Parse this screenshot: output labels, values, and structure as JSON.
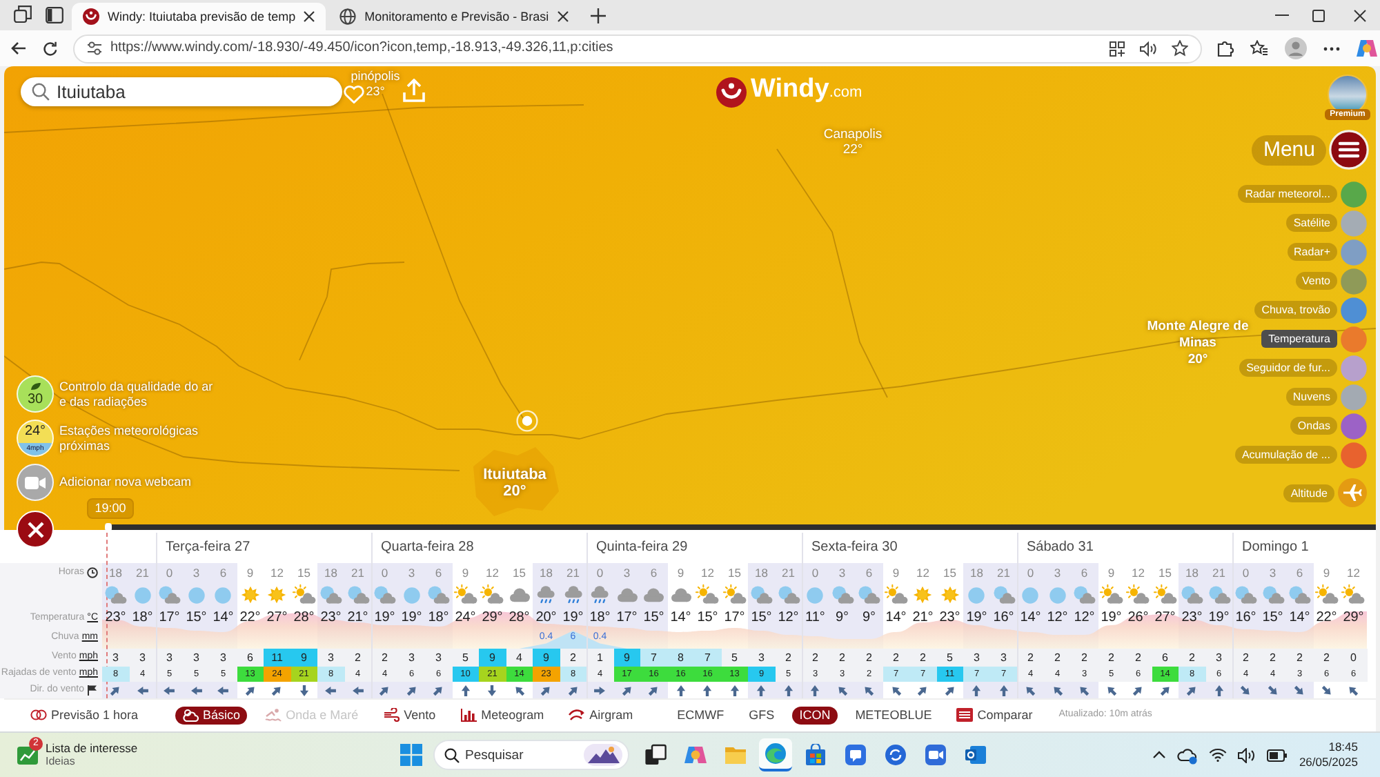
{
  "browser": {
    "tabs": [
      {
        "title": "Windy: Ituiutaba previsão de temp",
        "selected": true
      },
      {
        "title": "Monitoramento e Previsão - Brasi",
        "selected": false
      }
    ],
    "url": "https://www.windy.com/-18.930/-49.450/icon?icon,temp,-18.913,-49.326,11,p:cities"
  },
  "map": {
    "search": {
      "value": "Ituiutaba"
    },
    "logo": {
      "name": "Windy",
      "suffix": ".com"
    },
    "cities": [
      {
        "name": "pinópolis",
        "temp": "23°"
      },
      {
        "name": "Canapolis",
        "temp": "22°"
      },
      {
        "name": "Ituiutaba",
        "temp": "20°"
      },
      {
        "name": "Monte Alegre de Minas",
        "temp": "20°"
      }
    ],
    "premium": {
      "label": "Premium"
    },
    "menu": {
      "label": "Menu"
    },
    "layers": [
      {
        "label": "Radar meteorol...",
        "kind": "thumbnail",
        "color": "#58a84a",
        "selected": false
      },
      {
        "label": "Satélite",
        "kind": "thumbnail",
        "color": "#a4acb4",
        "selected": false
      },
      {
        "label": "Radar+",
        "kind": "thumbnail",
        "color": "#7f9ec4",
        "selected": false
      },
      {
        "label": "Vento",
        "kind": "thumbnail",
        "color": "#8f9a58",
        "selected": false
      },
      {
        "label": "Chuva, trovão",
        "kind": "thumbnail",
        "color": "#4f8fd4",
        "selected": false
      },
      {
        "label": "Temperatura",
        "kind": "thumbnail",
        "color": "#ea7a2c",
        "selected": true
      },
      {
        "label": "Seguidor de fur...",
        "kind": "thumbnail",
        "color": "#b7a0cc",
        "selected": false
      },
      {
        "label": "Nuvens",
        "kind": "thumbnail",
        "color": "#a3aab2",
        "selected": false
      },
      {
        "label": "Ondas",
        "kind": "thumbnail",
        "color": "#9c62c6",
        "selected": false
      },
      {
        "label": "Acumulação de ...",
        "kind": "thumbnail",
        "color": "#e8622e",
        "selected": false
      },
      {
        "label": "Altitude",
        "kind": "action",
        "color": "#e49b12",
        "selected": false
      }
    ],
    "tools": [
      {
        "kind": "air",
        "value": "30",
        "label": "Controlo da qualidade do ar e das radiações"
      },
      {
        "kind": "station",
        "value": "24°",
        "detail": "4mph",
        "label": "Estações meteorológicas próximas"
      },
      {
        "kind": "webcam",
        "label": "Adicionar nova webcam"
      }
    ],
    "timeline": {
      "time": "19:00",
      "level": 0
    }
  },
  "forecast": {
    "days": [
      {
        "hours": [
          {
            "hour": "18",
            "kind": "moon_cloud",
            "night": true,
            "temp": "23°",
            "wind": "3",
            "gust": "8",
            "wind_dir": {
              "kind": "ne"
            }
          },
          {
            "hour": "21",
            "kind": "moon",
            "night": true,
            "temp": "18°",
            "wind": "3",
            "gust": "4",
            "wind_dir": {
              "kind": "w"
            }
          }
        ]
      },
      {
        "label": "Terça-feira 27",
        "hours": [
          {
            "hour": "0",
            "kind": "moon_cloud",
            "night": true,
            "temp": "17°",
            "wind": "3",
            "gust": "5",
            "wind_dir": {
              "kind": "w"
            }
          },
          {
            "hour": "3",
            "kind": "moon",
            "night": true,
            "temp": "15°",
            "wind": "3",
            "gust": "5",
            "wind_dir": {
              "kind": "w"
            }
          },
          {
            "hour": "6",
            "kind": "moon",
            "night": true,
            "temp": "14°",
            "wind": "3",
            "gust": "5",
            "wind_dir": {
              "kind": "w"
            }
          },
          {
            "hour": "9",
            "kind": "sun",
            "night": false,
            "temp": "22°",
            "wind": "6",
            "gust": "13",
            "wind_dir": {
              "kind": "ne"
            }
          },
          {
            "hour": "12",
            "kind": "sun",
            "night": false,
            "temp": "27°",
            "wind": "11",
            "gust": "24",
            "wind_dir": {
              "kind": "ne"
            }
          },
          {
            "hour": "15",
            "kind": "sun_cloud",
            "night": false,
            "temp": "28°",
            "wind": "9",
            "gust": "21",
            "wind_dir": {
              "kind": "s"
            }
          },
          {
            "hour": "18",
            "kind": "moon_cloud",
            "night": true,
            "temp": "23°",
            "wind": "3",
            "gust": "8",
            "wind_dir": {
              "kind": "w"
            }
          },
          {
            "hour": "21",
            "kind": "moon_cloud",
            "night": true,
            "temp": "21°",
            "wind": "2",
            "gust": "4",
            "wind_dir": {
              "kind": "w"
            }
          }
        ]
      },
      {
        "label": "Quarta-feira 28",
        "hours": [
          {
            "hour": "0",
            "kind": "moon_cloud",
            "night": true,
            "temp": "19°",
            "wind": "2",
            "gust": "4",
            "wind_dir": {
              "kind": "ne"
            }
          },
          {
            "hour": "3",
            "kind": "moon",
            "night": true,
            "temp": "19°",
            "wind": "3",
            "gust": "6",
            "wind_dir": {
              "kind": "ne"
            }
          },
          {
            "hour": "6",
            "kind": "moon_cloud",
            "night": true,
            "temp": "18°",
            "wind": "3",
            "gust": "6",
            "wind_dir": {
              "kind": "ne"
            }
          },
          {
            "hour": "9",
            "kind": "sun_cloud",
            "night": false,
            "temp": "24°",
            "wind": "5",
            "gust": "10",
            "wind_dir": {
              "kind": "n"
            }
          },
          {
            "hour": "12",
            "kind": "sun_cloud",
            "night": false,
            "temp": "29°",
            "wind": "9",
            "gust": "21",
            "wind_dir": {
              "kind": "s"
            }
          },
          {
            "hour": "15",
            "kind": "cloud",
            "night": false,
            "temp": "28°",
            "wind": "4",
            "gust": "14",
            "wind_dir": {
              "kind": "nw"
            }
          },
          {
            "hour": "18",
            "kind": "rain",
            "night": true,
            "temp": "20°",
            "rain": "0.4",
            "wind": "9",
            "gust": "23",
            "wind_dir": {
              "kind": "ne"
            }
          },
          {
            "hour": "21",
            "kind": "rain",
            "night": true,
            "temp": "19°",
            "rain": "6",
            "wind": "2",
            "gust": "8",
            "wind_dir": {
              "kind": "ne"
            }
          }
        ]
      },
      {
        "label": "Quinta-feira 29",
        "hours": [
          {
            "hour": "0",
            "kind": "rain",
            "night": true,
            "temp": "18°",
            "rain": "0.4",
            "wind": "1",
            "gust": "4",
            "wind_dir": {
              "kind": "e"
            }
          },
          {
            "hour": "3",
            "kind": "cloud",
            "night": true,
            "temp": "17°",
            "wind": "9",
            "gust": "17",
            "wind_dir": {
              "kind": "ne"
            }
          },
          {
            "hour": "6",
            "kind": "cloud",
            "night": true,
            "temp": "15°",
            "wind": "7",
            "gust": "16",
            "wind_dir": {
              "kind": "ne"
            }
          },
          {
            "hour": "9",
            "kind": "cloud",
            "night": false,
            "temp": "14°",
            "wind": "8",
            "gust": "16",
            "wind_dir": {
              "kind": "n"
            }
          },
          {
            "hour": "12",
            "kind": "sun_cloud",
            "night": false,
            "temp": "15°",
            "wind": "7",
            "gust": "16",
            "wind_dir": {
              "kind": "n"
            }
          },
          {
            "hour": "15",
            "kind": "sun_cloud",
            "night": false,
            "temp": "17°",
            "wind": "5",
            "gust": "13",
            "wind_dir": {
              "kind": "n"
            }
          },
          {
            "hour": "18",
            "kind": "moon_cloud",
            "night": true,
            "temp": "15°",
            "wind": "3",
            "gust": "9",
            "wind_dir": {
              "kind": "n"
            }
          },
          {
            "hour": "21",
            "kind": "moon_cloud",
            "night": true,
            "temp": "12°",
            "wind": "2",
            "gust": "5",
            "wind_dir": {
              "kind": "n"
            }
          }
        ]
      },
      {
        "label": "Sexta-feira 30",
        "hours": [
          {
            "hour": "0",
            "kind": "moon",
            "night": true,
            "temp": "11°",
            "wind": "2",
            "gust": "3",
            "wind_dir": {
              "kind": "n"
            }
          },
          {
            "hour": "3",
            "kind": "moon_cloud",
            "night": true,
            "temp": "9°",
            "wind": "2",
            "gust": "3",
            "wind_dir": {
              "kind": "nw"
            }
          },
          {
            "hour": "6",
            "kind": "moon_cloud",
            "night": true,
            "temp": "9°",
            "wind": "2",
            "gust": "2",
            "wind_dir": {
              "kind": "nw"
            }
          },
          {
            "hour": "9",
            "kind": "sun_cloud",
            "night": false,
            "temp": "14°",
            "wind": "2",
            "gust": "7",
            "wind_dir": {
              "kind": "nw"
            }
          },
          {
            "hour": "12",
            "kind": "sun",
            "night": false,
            "temp": "21°",
            "wind": "2",
            "gust": "7",
            "wind_dir": {
              "kind": "ne"
            }
          },
          {
            "hour": "15",
            "kind": "sun",
            "night": false,
            "temp": "23°",
            "wind": "5",
            "gust": "11",
            "wind_dir": {
              "kind": "ne"
            }
          },
          {
            "hour": "18",
            "kind": "moon",
            "night": true,
            "temp": "19°",
            "wind": "3",
            "gust": "7",
            "wind_dir": {
              "kind": "n"
            }
          },
          {
            "hour": "21",
            "kind": "moon_cloud",
            "night": true,
            "temp": "16°",
            "wind": "3",
            "gust": "7",
            "wind_dir": {
              "kind": "n"
            }
          }
        ]
      },
      {
        "label": "Sábado 31",
        "hours": [
          {
            "hour": "0",
            "kind": "moon",
            "night": true,
            "temp": "14°",
            "wind": "2",
            "gust": "4",
            "wind_dir": {
              "kind": "nw"
            }
          },
          {
            "hour": "3",
            "kind": "moon",
            "night": true,
            "temp": "12°",
            "wind": "2",
            "gust": "4",
            "wind_dir": {
              "kind": "nw"
            }
          },
          {
            "hour": "6",
            "kind": "moon_cloud",
            "night": true,
            "temp": "12°",
            "wind": "2",
            "gust": "3",
            "wind_dir": {
              "kind": "nw"
            }
          },
          {
            "hour": "9",
            "kind": "sun_cloud",
            "night": false,
            "temp": "19°",
            "wind": "2",
            "gust": "5",
            "wind_dir": {
              "kind": "nw"
            }
          },
          {
            "hour": "12",
            "kind": "sun_cloud",
            "night": false,
            "temp": "26°",
            "wind": "2",
            "gust": "6",
            "wind_dir": {
              "kind": "ne"
            }
          },
          {
            "hour": "15",
            "kind": "sun_cloud",
            "night": false,
            "temp": "27°",
            "wind": "6",
            "gust": "14",
            "wind_dir": {
              "kind": "ne"
            }
          },
          {
            "hour": "18",
            "kind": "moon_cloud",
            "night": true,
            "temp": "23°",
            "wind": "2",
            "gust": "8",
            "wind_dir": {
              "kind": "ne"
            }
          },
          {
            "hour": "21",
            "kind": "moon_cloud",
            "night": true,
            "temp": "19°",
            "wind": "3",
            "gust": "6",
            "wind_dir": {
              "kind": "n"
            }
          }
        ]
      },
      {
        "label": "Domingo 1",
        "hours": [
          {
            "hour": "0",
            "kind": "moon_cloud",
            "night": true,
            "temp": "16°",
            "wind": "2",
            "gust": "4",
            "wind_dir": {
              "kind": "se"
            }
          },
          {
            "hour": "3",
            "kind": "moon_cloud",
            "night": true,
            "temp": "15°",
            "wind": "2",
            "gust": "4",
            "wind_dir": {
              "kind": "se"
            }
          },
          {
            "hour": "6",
            "kind": "moon_cloud",
            "night": true,
            "temp": "14°",
            "wind": "2",
            "gust": "3",
            "wind_dir": {
              "kind": "se"
            }
          },
          {
            "hour": "9",
            "kind": "sun_cloud",
            "night": false,
            "temp": "22°",
            "wind": "2",
            "gust": "6",
            "wind_dir": {
              "kind": "se"
            }
          },
          {
            "hour": "12",
            "kind": "sun_cloud",
            "night": false,
            "temp": "29°",
            "wind": "0",
            "gust": "6",
            "wind_dir": {
              "kind": "nw"
            }
          }
        ]
      }
    ],
    "rows": [
      {
        "kind": "hours",
        "label": "Horas"
      },
      {
        "kind": "temp",
        "label": "Temperatura",
        "unit": "°C"
      },
      {
        "kind": "rain",
        "label": "Chuva",
        "unit": "mm"
      },
      {
        "kind": "wind",
        "label": "Vento",
        "unit": "mph"
      },
      {
        "kind": "gust",
        "label": "Rajadas de vento",
        "unit": "mph"
      },
      {
        "kind": "dir",
        "label": "Dir. do vento"
      }
    ],
    "toolbar": {
      "hourly": {
        "label": "Previsão 1 hora"
      },
      "presets": [
        {
          "kind": "basic",
          "label": "Básico",
          "selected": true,
          "disabled": false
        },
        {
          "kind": "wave",
          "label": "Onda e Maré",
          "selected": false,
          "disabled": true
        },
        {
          "kind": "wind",
          "label": "Vento",
          "selected": false,
          "disabled": false
        },
        {
          "kind": "meteogram",
          "label": "Meteogram",
          "selected": false,
          "disabled": false
        },
        {
          "kind": "airgram",
          "label": "Airgram",
          "selected": false,
          "disabled": false
        }
      ],
      "models": [
        {
          "label": "ECMWF",
          "selected": false
        },
        {
          "label": "GFS",
          "selected": false
        },
        {
          "label": "ICON",
          "selected": true
        },
        {
          "label": "METEOBLUE",
          "selected": false
        }
      ],
      "compare": {
        "label": "Comparar"
      },
      "updated": "Atualizado: 10m atrás"
    }
  },
  "taskbar": {
    "widget": {
      "title": "Lista de interesse",
      "subtitle": "Ideias",
      "badge": "2"
    },
    "search": {
      "placeholder": "Pesquisar"
    },
    "apps": [
      {
        "kind": "task_view",
        "selected": false
      },
      {
        "kind": "assistant",
        "selected": false
      },
      {
        "kind": "folder",
        "selected": false
      },
      {
        "kind": "browser",
        "selected": true
      },
      {
        "kind": "store",
        "selected": false
      },
      {
        "kind": "chat",
        "selected": false
      },
      {
        "kind": "sync",
        "selected": false
      },
      {
        "kind": "video",
        "selected": false
      },
      {
        "kind": "mail",
        "selected": false
      }
    ],
    "clock": {
      "time": "18:45",
      "date": "26/05/2025"
    }
  }
}
